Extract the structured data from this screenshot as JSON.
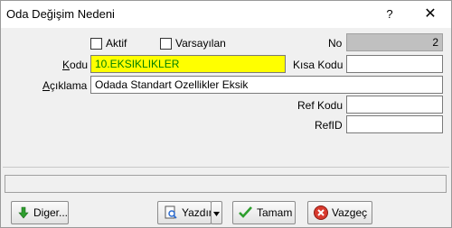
{
  "window": {
    "title": "Oda Değişim Nedeni",
    "help_glyph": "?",
    "close_glyph": "✕"
  },
  "form": {
    "aktif_label": "Aktif",
    "varsayilan_label": "Varsayılan",
    "no_label": "No",
    "no_value": "2",
    "kodu_label": "Kodu",
    "kodu_value": "10.EKSIKLIKLER",
    "kisa_kodu_label": "Kısa Kodu",
    "kisa_kodu_value": "",
    "aciklama_label": "Açıklama",
    "aciklama_value": "Odada Standart Ozellikler Eksik",
    "ref_kodu_label": "Ref Kodu",
    "ref_kodu_value": "",
    "refid_label": "RefID",
    "refid_value": ""
  },
  "status": {
    "text": ""
  },
  "buttons": {
    "diger": "Diger...",
    "yazdir": "Yazdır",
    "tamam": "Tamam",
    "vazgec": "Vazgeç"
  },
  "colors": {
    "highlight_field": "#ffff00",
    "highlight_text": "#008000",
    "no_field_bg": "#c0c0c0"
  },
  "icons": {
    "diger": "arrow-down-icon",
    "yazdir": "print-preview-icon",
    "tamam": "checkmark-icon",
    "vazgec": "cancel-icon"
  }
}
